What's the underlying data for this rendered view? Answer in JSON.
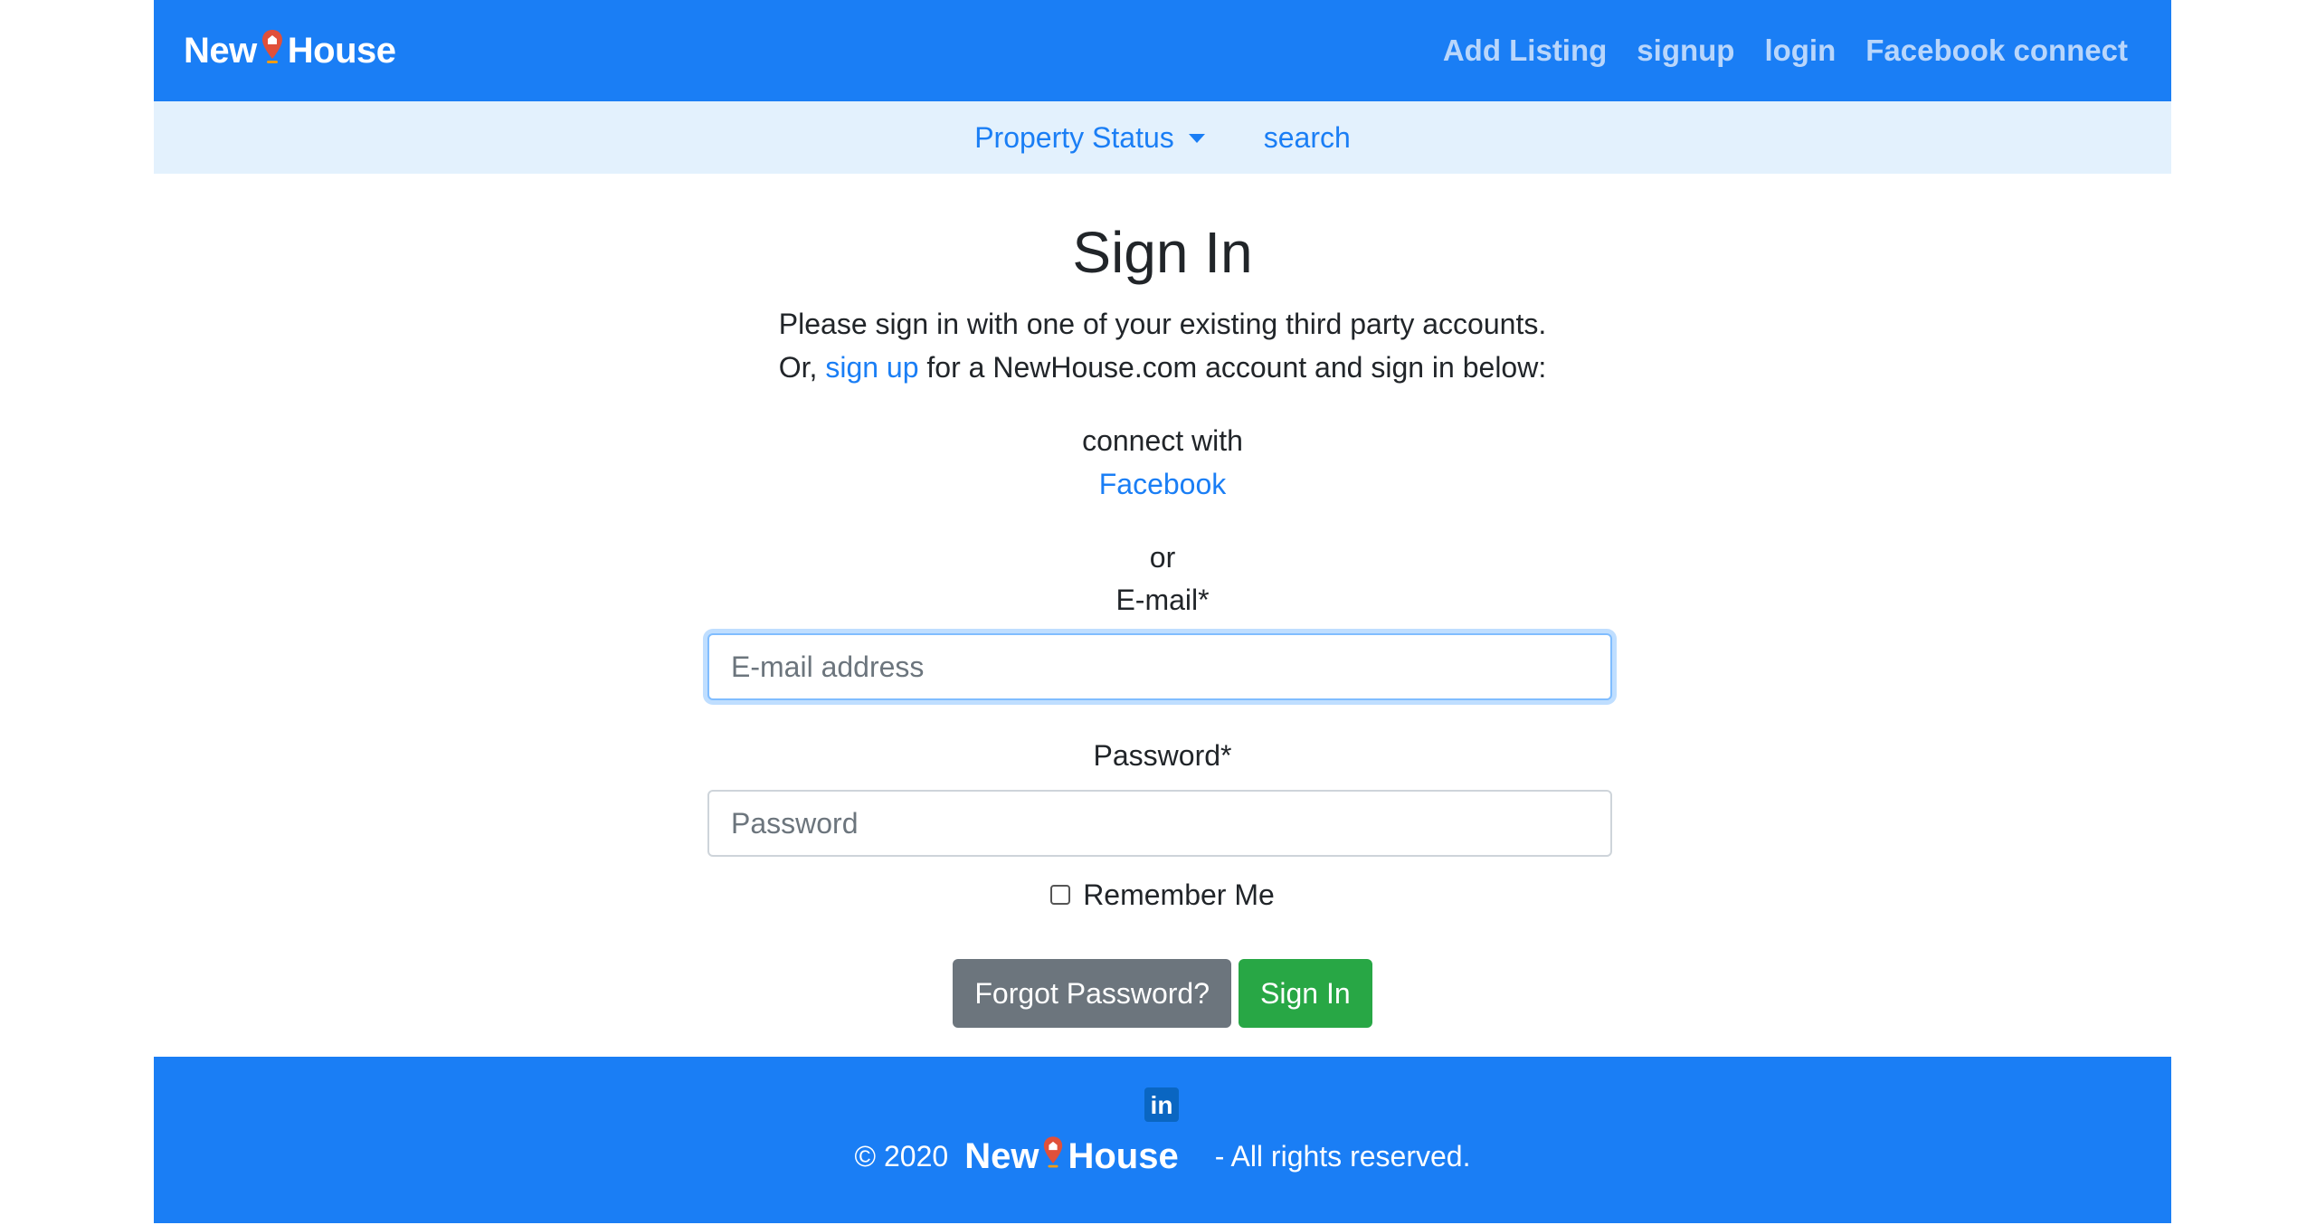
{
  "navbar": {
    "brand_left": "New",
    "brand_right": "House",
    "links": [
      "Add Listing",
      "signup",
      "login",
      "Facebook connect"
    ]
  },
  "subnav": {
    "dropdown_label": "Property Status",
    "search_label": "search"
  },
  "signin": {
    "title": "Sign In",
    "line1": "Please sign in with one of your existing third party accounts.",
    "line2_prefix": "Or,",
    "line2_link": "sign up",
    "line2_suffix": "for a NewHouse.com account and sign in below:",
    "connect_with": "connect with",
    "facebook": "Facebook",
    "or": "or",
    "email_label": "E-mail*",
    "email_placeholder": "E-mail address",
    "password_label": "Password*",
    "password_placeholder": "Password",
    "remember_me": "Remember Me",
    "forgot_button": "Forgot Password?",
    "signin_button": "Sign In"
  },
  "footer": {
    "linkedin": "in",
    "copyright": "© 2020",
    "brand_left": "New",
    "brand_right": "House",
    "rights": "- All rights reserved."
  },
  "colors": {
    "primary": "#1a7ef5",
    "subnav_bg": "#e3f1fd",
    "success": "#28a745",
    "secondary": "#6c757d"
  },
  "icons": [
    "map-pin-icon",
    "caret-down-icon",
    "linkedin-icon"
  ]
}
